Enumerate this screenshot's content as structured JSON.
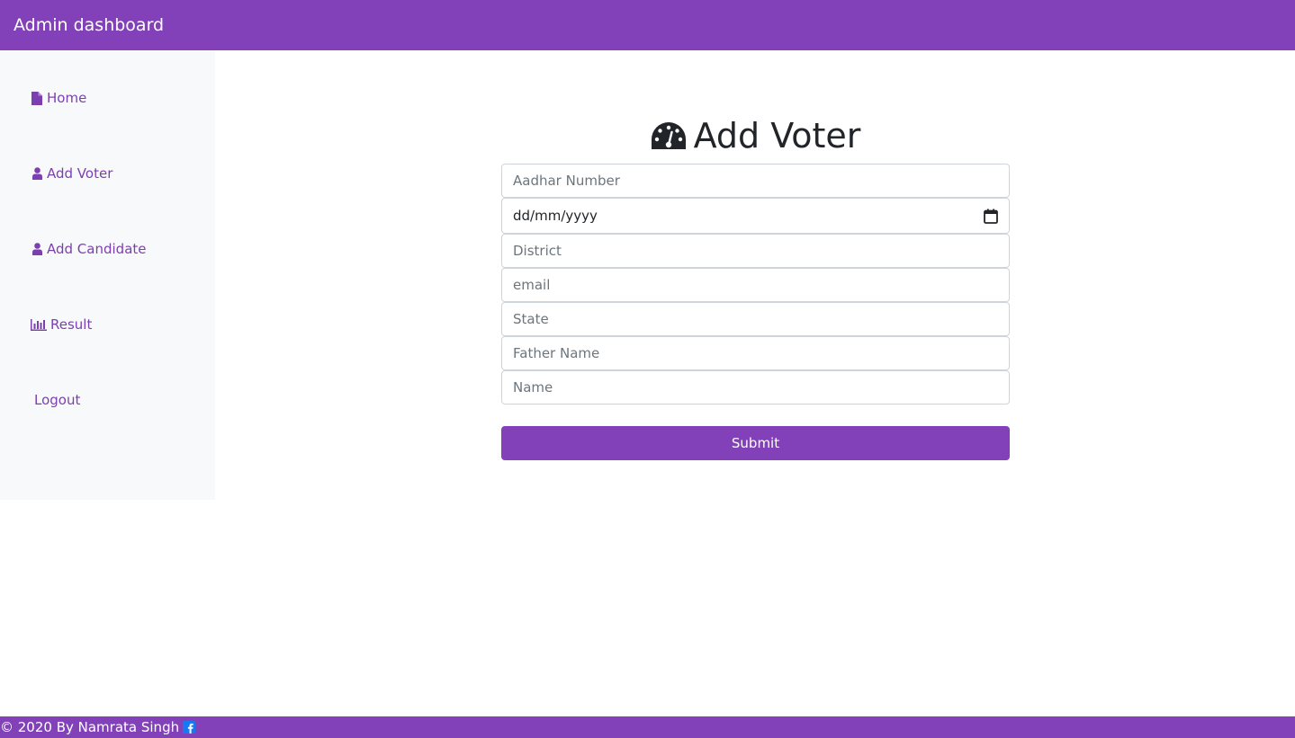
{
  "header": {
    "title": "Admin dashboard"
  },
  "sidebar": {
    "items": [
      {
        "label": "Home",
        "icon": "file-icon"
      },
      {
        "label": "Add Voter",
        "icon": "user-icon"
      },
      {
        "label": "Add Candidate",
        "icon": "user-icon"
      },
      {
        "label": "Result",
        "icon": "bar-chart-icon"
      },
      {
        "label": "Logout",
        "icon": ""
      }
    ]
  },
  "main": {
    "title": "Add Voter",
    "title_icon": "tachometer-icon",
    "fields": {
      "aadhar": {
        "placeholder": "Aadhar Number"
      },
      "dob": {
        "value": "dd/mm/yyyy"
      },
      "district": {
        "placeholder": "District"
      },
      "email": {
        "placeholder": "email"
      },
      "state": {
        "placeholder": "State"
      },
      "father_name": {
        "placeholder": "Father Name"
      },
      "name": {
        "placeholder": "Name"
      }
    },
    "submit_label": "Submit"
  },
  "footer": {
    "text": "© 2020 By Namrata Singh",
    "icon": "facebook-icon"
  },
  "colors": {
    "brand": "#8241b8",
    "sidebar_bg": "#f8f9fa",
    "link": "#7c3fb0"
  }
}
